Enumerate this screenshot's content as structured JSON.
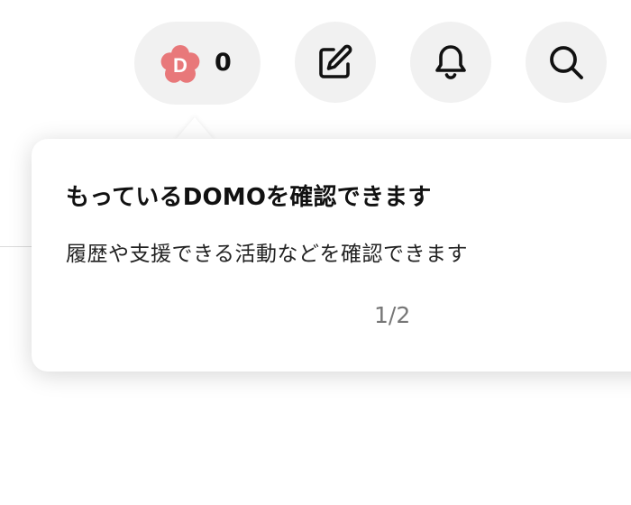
{
  "header": {
    "domo": {
      "badge_letter": "D",
      "count": "0",
      "badge_color": "#e8787a"
    },
    "icons": {
      "edit": "edit-icon",
      "bell": "bell-icon",
      "search": "search-icon"
    }
  },
  "popover": {
    "title": "もっているDOMOを確認できます",
    "body": "履歴や支援できる活動などを確認できます",
    "page_indicator": "1/2"
  },
  "colors": {
    "button_bg": "#f1f1f1",
    "text_primary": "#111111",
    "text_muted": "#777777"
  }
}
